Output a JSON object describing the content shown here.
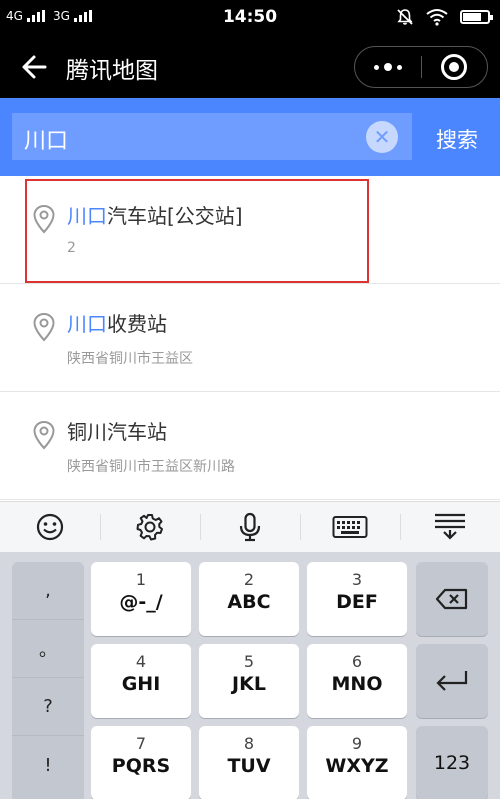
{
  "status_bar": {
    "network1": "4G",
    "network2": "3G",
    "time": "14:50"
  },
  "nav": {
    "title": "腾讯地图"
  },
  "search": {
    "query": "川口",
    "clear_symbol": "✕",
    "button_label": "搜索"
  },
  "results": [
    {
      "highlight": "川口",
      "rest": "汽车站[公交站]",
      "subtitle": "2"
    },
    {
      "highlight": "川口",
      "rest": "收费站",
      "subtitle": "陕西省铜川市王益区"
    },
    {
      "highlight": "",
      "rest": "铜川汽车站",
      "subtitle": "陕西省铜川市王益区新川路"
    }
  ],
  "keyboard": {
    "symbols": [
      ",",
      "。",
      "?",
      "!"
    ],
    "keys": [
      {
        "num": "1",
        "letters": "@-_/"
      },
      {
        "num": "2",
        "letters": "ABC"
      },
      {
        "num": "3",
        "letters": "DEF"
      },
      {
        "num": "4",
        "letters": "GHI"
      },
      {
        "num": "5",
        "letters": "JKL"
      },
      {
        "num": "6",
        "letters": "MNO"
      },
      {
        "num": "7",
        "letters": "PQRS"
      },
      {
        "num": "8",
        "letters": "TUV"
      },
      {
        "num": "9",
        "letters": "WXYZ"
      }
    ],
    "mode_key": "123"
  },
  "colors": {
    "accent": "#4c86ff",
    "selection_border": "#dd3333"
  }
}
